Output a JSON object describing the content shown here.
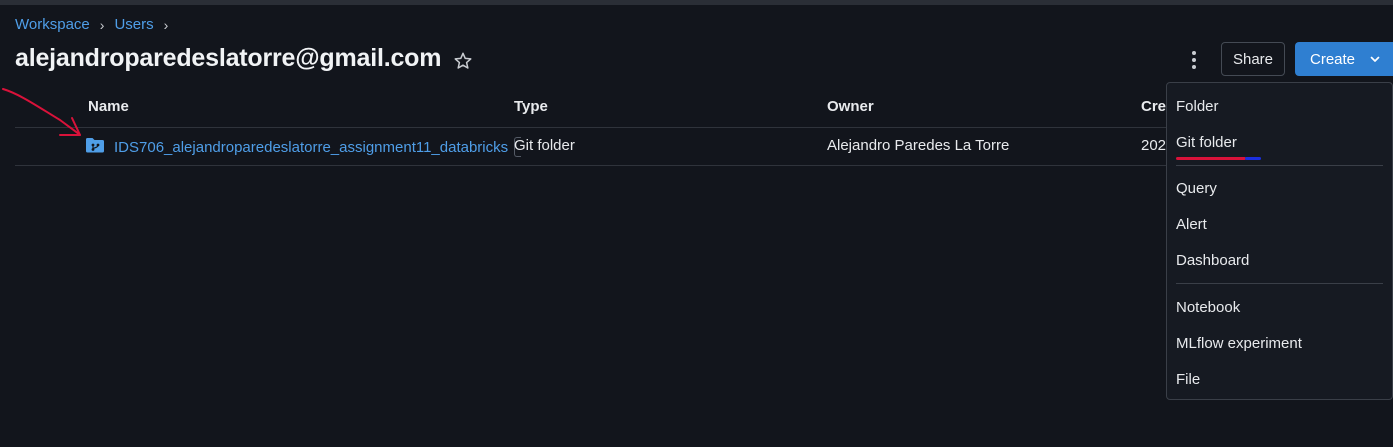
{
  "breadcrumb": {
    "items": [
      "Workspace",
      "Users"
    ],
    "separator": "›"
  },
  "page": {
    "title": "alejandroparedeslatorre@gmail.com"
  },
  "header_actions": {
    "share_label": "Share",
    "create_label": "Create"
  },
  "table": {
    "columns": [
      "Name",
      "Type",
      "Owner",
      "Crea"
    ],
    "rows": [
      {
        "name": "IDS706_alejandroparedeslatorre_assignment11_databricks",
        "type": "Git folder",
        "owner": "Alejandro Paredes La Torre",
        "created": "202"
      }
    ]
  },
  "create_menu": {
    "items": [
      "Folder",
      "Git folder",
      "Query",
      "Alert",
      "Dashboard",
      "Notebook",
      "MLflow experiment",
      "File"
    ]
  },
  "icons": {
    "star": "star-outline-icon",
    "more": "kebab-icon",
    "chevron": "chevron-down-icon",
    "git_folder": "git-folder-icon"
  },
  "colors": {
    "background": "#12151c",
    "link": "#4f9ee8",
    "primary_button": "#2f7fd1",
    "annotation_red": "#d9123a",
    "annotation_blue": "#1b2fe0"
  }
}
